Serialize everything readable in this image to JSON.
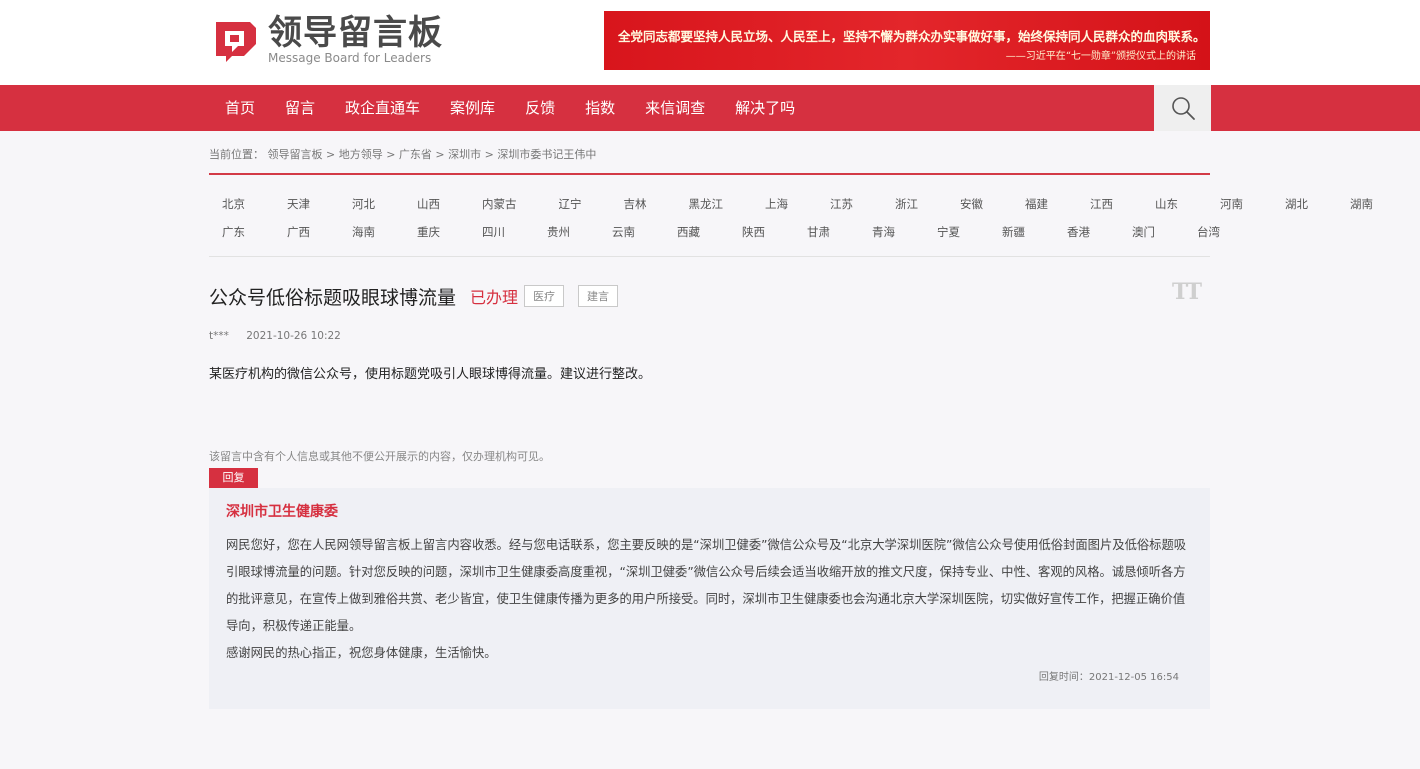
{
  "header": {
    "logo_cn": "领导留言板",
    "logo_en": "Message Board for Leaders",
    "banner_line1": "全党同志都要坚持人民立场、人民至上，坚持不懈为群众办实事做好事，始终保持同人民群众的血肉联系。",
    "banner_line2": "——习近平在“七一勋章”颁授仪式上的讲话"
  },
  "nav": {
    "items": [
      "首页",
      "留言",
      "政企直通车",
      "案例库",
      "反馈",
      "指数",
      "来信调查",
      "解决了吗"
    ]
  },
  "breadcrumb": "当前位置： 领导留言板 > 地方领导 > 广东省 > 深圳市 > 深圳市委书记王伟中",
  "provinces": {
    "row1": [
      "北京",
      "天津",
      "河北",
      "山西",
      "内蒙古",
      "辽宁",
      "吉林",
      "黑龙江",
      "上海",
      "江苏",
      "浙江",
      "安徽",
      "福建",
      "江西",
      "山东",
      "河南",
      "湖北",
      "湖南"
    ],
    "row2": [
      "广东",
      "广西",
      "海南",
      "重庆",
      "四川",
      "贵州",
      "云南",
      "西藏",
      "陕西",
      "甘肃",
      "青海",
      "宁夏",
      "新疆",
      "香港",
      "澳门",
      "台湾"
    ]
  },
  "message": {
    "title": "公众号低俗标题吸眼球博流量",
    "status": "已办理",
    "tags": [
      "医疗",
      "建言"
    ],
    "author": "t***",
    "date": "2021-10-26 10:22",
    "body": "某医疗机构的微信公众号，使用标题党吸引人眼球博得流量。建议进行整改。",
    "privacy_note": "该留言中含有个人信息或其他不便公开展示的内容，仅办理机构可见。",
    "font_toggle": "TT"
  },
  "reply": {
    "tab_label": "回复",
    "org": "深圳市卫生健康委",
    "text": "网民您好，您在人民网领导留言板上留言内容收悉。经与您电话联系，您主要反映的是“深圳卫健委”微信公众号及“北京大学深圳医院”微信公众号使用低俗封面图片及低俗标题吸引眼球博流量的问题。针对您反映的问题，深圳市卫生健康委高度重视，“深圳卫健委”微信公众号后续会适当收缩开放的推文尺度，保持专业、中性、客观的风格。诚恳倾听各方的批评意见，在宣传上做到雅俗共赏、老少皆宜，使卫生健康传播为更多的用户所接受。同时，深圳市卫生健康委也会沟通北京大学深圳医院，切实做好宣传工作，把握正确价值导向，积极传递正能量。",
    "thanks": "感谢网民的热心指正，祝您身体健康，生活愉快。",
    "time": "回复时间：2021-12-05 16:54"
  },
  "colors": {
    "brand_red": "#d63040",
    "nav_red": "#d63040",
    "reply_bg": "#eff0f5"
  }
}
